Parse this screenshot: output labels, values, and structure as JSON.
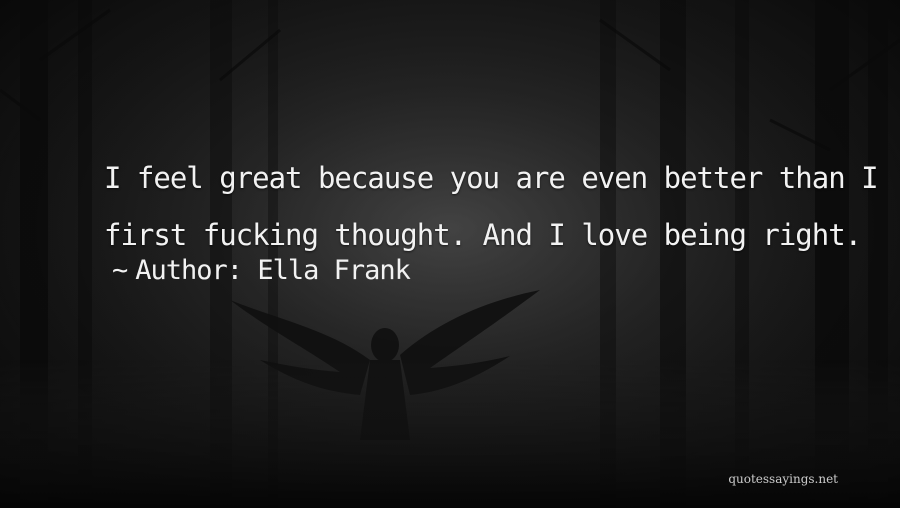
{
  "quote": {
    "line1": "I feel great because you are even better than I",
    "line2": "first fucking thought. And I love being right."
  },
  "author": {
    "tilde": "~",
    "label": "Author:",
    "name": "Ella Frank"
  },
  "watermark": "quotessayings.net",
  "colors": {
    "text": "#f2f2f2",
    "background": "#1a1a1a"
  }
}
